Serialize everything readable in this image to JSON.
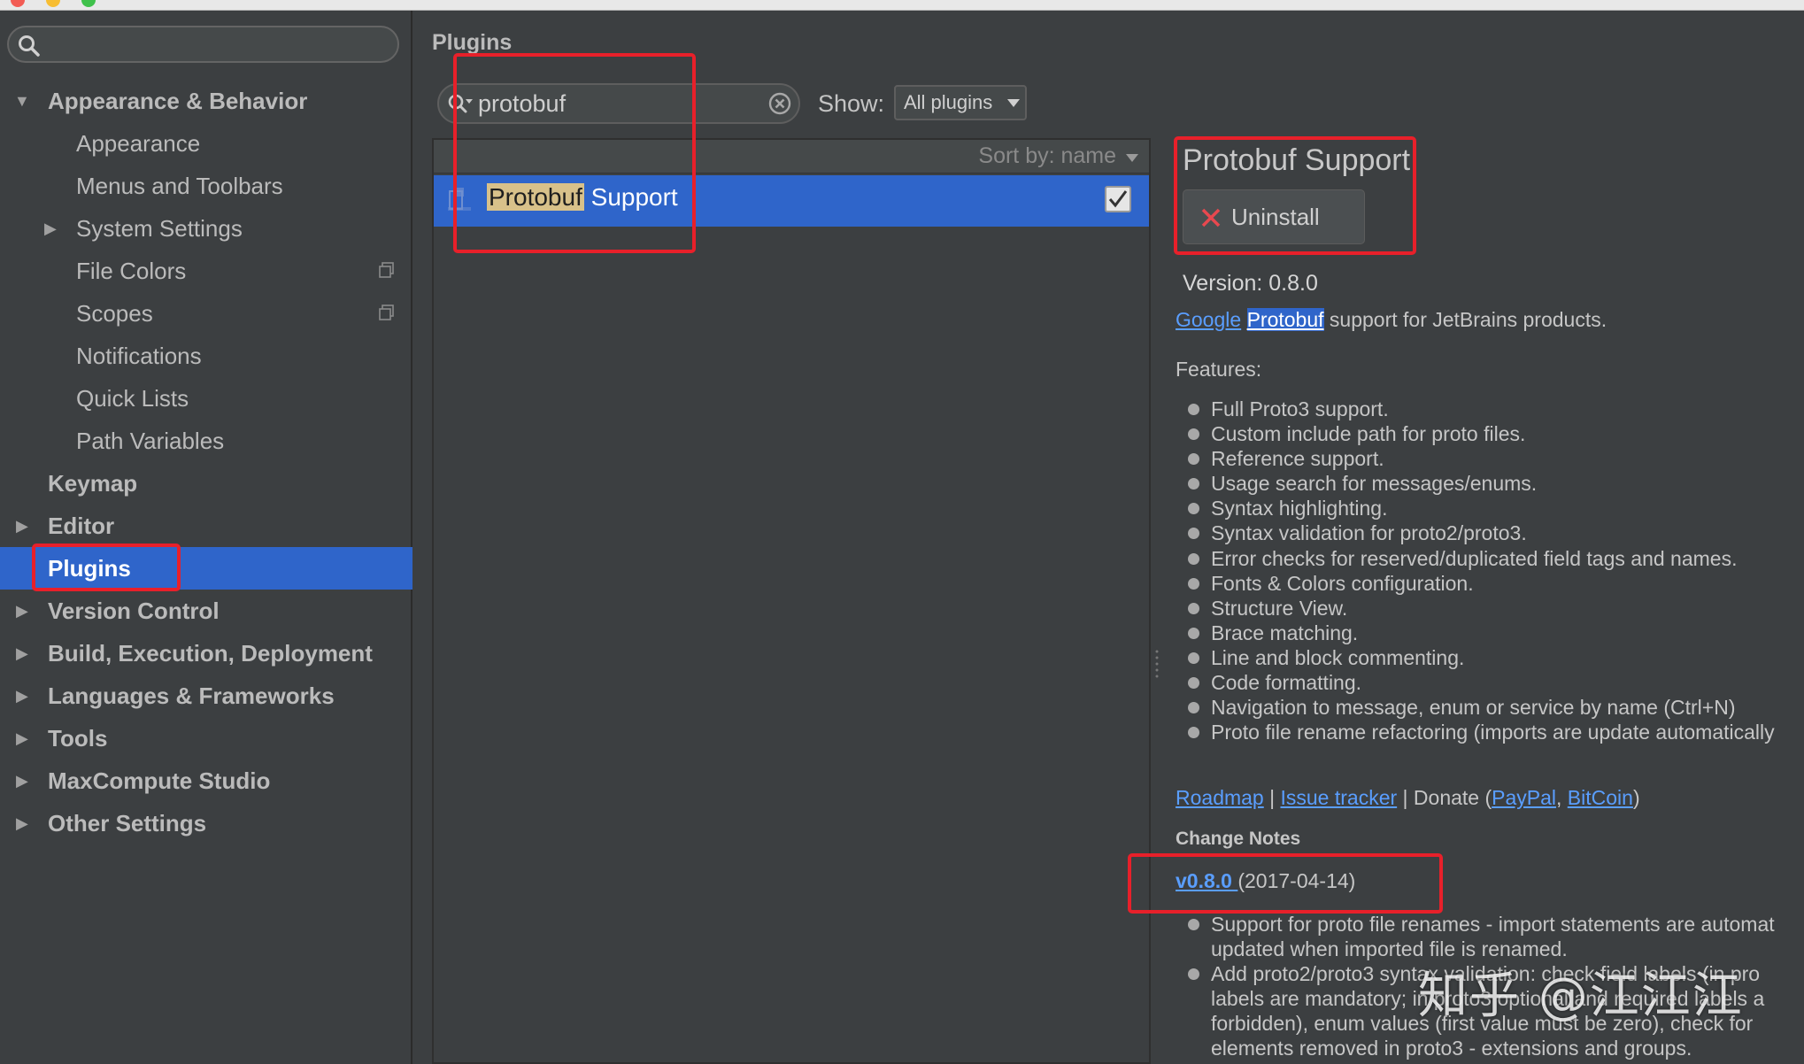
{
  "sidebar": {
    "search_placeholder": "",
    "items": [
      {
        "label": "Appearance & Behavior",
        "expanded": true
      },
      {
        "label": "Appearance"
      },
      {
        "label": "Menus and Toolbars"
      },
      {
        "label": "System Settings"
      },
      {
        "label": "File Colors"
      },
      {
        "label": "Scopes"
      },
      {
        "label": "Notifications"
      },
      {
        "label": "Quick Lists"
      },
      {
        "label": "Path Variables"
      },
      {
        "label": "Keymap"
      },
      {
        "label": "Editor"
      },
      {
        "label": "Plugins",
        "selected": true
      },
      {
        "label": "Version Control"
      },
      {
        "label": "Build, Execution, Deployment"
      },
      {
        "label": "Languages & Frameworks"
      },
      {
        "label": "Tools"
      },
      {
        "label": "MaxCompute Studio"
      },
      {
        "label": "Other Settings"
      }
    ]
  },
  "main": {
    "title": "Plugins",
    "search_value": "protobuf",
    "show_label": "Show:",
    "show_value": "All plugins",
    "sort_label": "Sort by: name",
    "plugin_row": {
      "highlight": "Protobuf",
      "rest": " Support",
      "checked": true
    }
  },
  "detail": {
    "title": "Protobuf Support",
    "uninstall_label": "Uninstall",
    "version": "Version: 0.8.0",
    "desc_link1": "Google",
    "desc_link2": "Protobuf",
    "desc_rest": " support for JetBrains products.",
    "features_heading": "Features:",
    "features": [
      "Full Proto3 support.",
      "Custom include path for proto files.",
      "Reference support.",
      "Usage search for messages/enums.",
      "Syntax highlighting.",
      "Syntax validation for proto2/proto3.",
      "Error checks for reserved/duplicated field tags and names.",
      "Fonts & Colors configuration.",
      "Structure View.",
      "Brace matching.",
      "Line and block commenting.",
      "Code formatting.",
      "Navigation to message, enum or service by name (Ctrl+N)",
      "Proto file rename refactoring (imports are update automatically"
    ],
    "links": {
      "roadmap": "Roadmap",
      "sep1": " | ",
      "issue_tracker": "Issue tracker",
      "donate": " | Donate (",
      "paypal": "PayPal",
      "comma": ", ",
      "bitcoin": "BitCoin",
      "close": ")"
    },
    "change_notes_heading": "Change Notes",
    "cn_version_link": "v0.8.0 ",
    "cn_date": "(2017-04-14)",
    "notes": [
      "Support for proto file renames - import statements are automat",
      "updated when imported file is renamed.",
      "Add proto2/proto3 syntax validation: check field labels (in pro",
      "labels are mandatory; in proto3 optional and required labels a",
      "forbidden), enum values (first value must be zero), check for",
      "elements removed in proto3 - extensions and groups."
    ]
  },
  "watermark": "知乎 @江江江",
  "colors": {
    "accent": "#2f65ca",
    "annotation": "#e8202a",
    "link": "#5a9eff"
  }
}
